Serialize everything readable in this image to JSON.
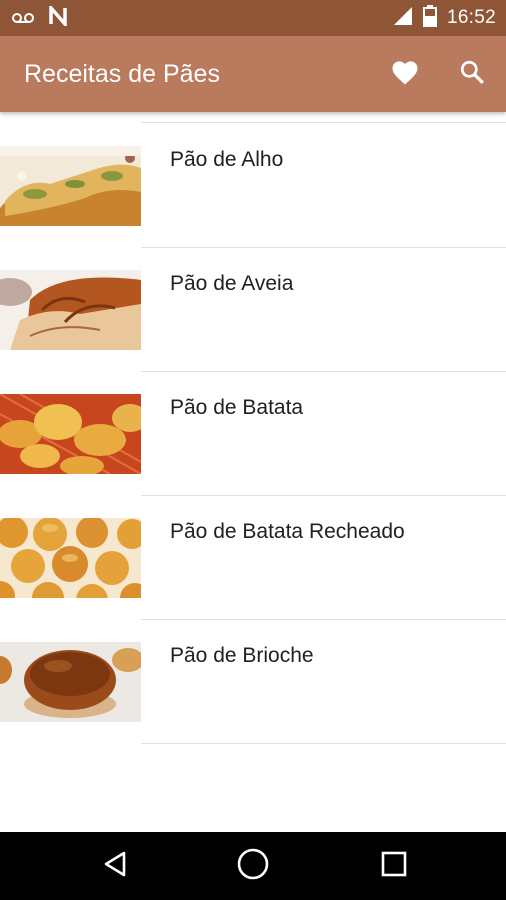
{
  "status_bar": {
    "time": "16:52",
    "icons": [
      "voicemail-icon",
      "n-notification-icon",
      "signal-icon",
      "battery-icon"
    ]
  },
  "app_bar": {
    "title": "Receitas de Pães",
    "actions": [
      "heart-icon",
      "search-icon"
    ]
  },
  "recipes": [
    {
      "name": "Pão de Alho"
    },
    {
      "name": "Pão de Aveia"
    },
    {
      "name": "Pão de Batata"
    },
    {
      "name": "Pão de Batata Recheado"
    },
    {
      "name": "Pão de Brioche"
    }
  ],
  "nav_bar": {
    "buttons": [
      "back-icon",
      "home-icon",
      "recents-icon"
    ]
  },
  "colors": {
    "status_bar": "#8e5636",
    "app_bar": "#b97a5d",
    "text": "#212121",
    "divider": "#e0e0e0"
  }
}
